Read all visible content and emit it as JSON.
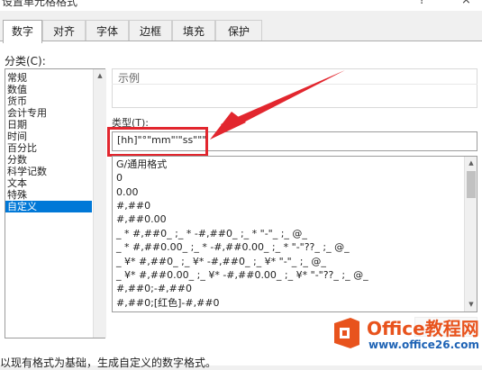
{
  "title": "设置单元格格式",
  "window_buttons": {
    "help": "?",
    "close": "×"
  },
  "tabs": [
    {
      "label": "数字",
      "active": true
    },
    {
      "label": "对齐",
      "active": false
    },
    {
      "label": "字体",
      "active": false
    },
    {
      "label": "边框",
      "active": false
    },
    {
      "label": "填充",
      "active": false
    },
    {
      "label": "保护",
      "active": false
    }
  ],
  "category": {
    "label": "分类(C):",
    "items": [
      "常规",
      "数值",
      "货币",
      "会计专用",
      "日期",
      "时间",
      "百分比",
      "分数",
      "科学记数",
      "文本",
      "特殊",
      "自定义"
    ],
    "selected": "自定义"
  },
  "sample": {
    "label": "示例"
  },
  "type": {
    "label": "类型(T):",
    "value": "[hh]\"°\"mm\"'\"ss\"\"\""
  },
  "formats": [
    "G/通用格式",
    "0",
    "0.00",
    "#,##0",
    "#,##0.00",
    "_ * #,##0_ ;_ * -#,##0_ ;_ * \"-\"_ ;_ @_",
    "_ * #,##0.00_ ;_ * -#,##0.00_ ;_ * \"-\"??_ ;_ @_",
    "_ ¥* #,##0_ ;_ ¥* -#,##0_ ;_ ¥* \"-\"_ ;_ @_",
    "_ ¥* #,##0.00_ ;_ ¥* -#,##0.00_ ;_ ¥* \"-\"??_ ;_ @_",
    "#,##0;-#,##0",
    "#,##0;[红色]-#,##0"
  ],
  "description": "以现有格式为基础，生成自定义的数字格式。",
  "watermark": {
    "brand": "Office教程网",
    "url": "www.office26.com"
  },
  "colors": {
    "selection": "#0078d7",
    "highlight": "#e2262e",
    "brand_orange": "#e8531d"
  }
}
